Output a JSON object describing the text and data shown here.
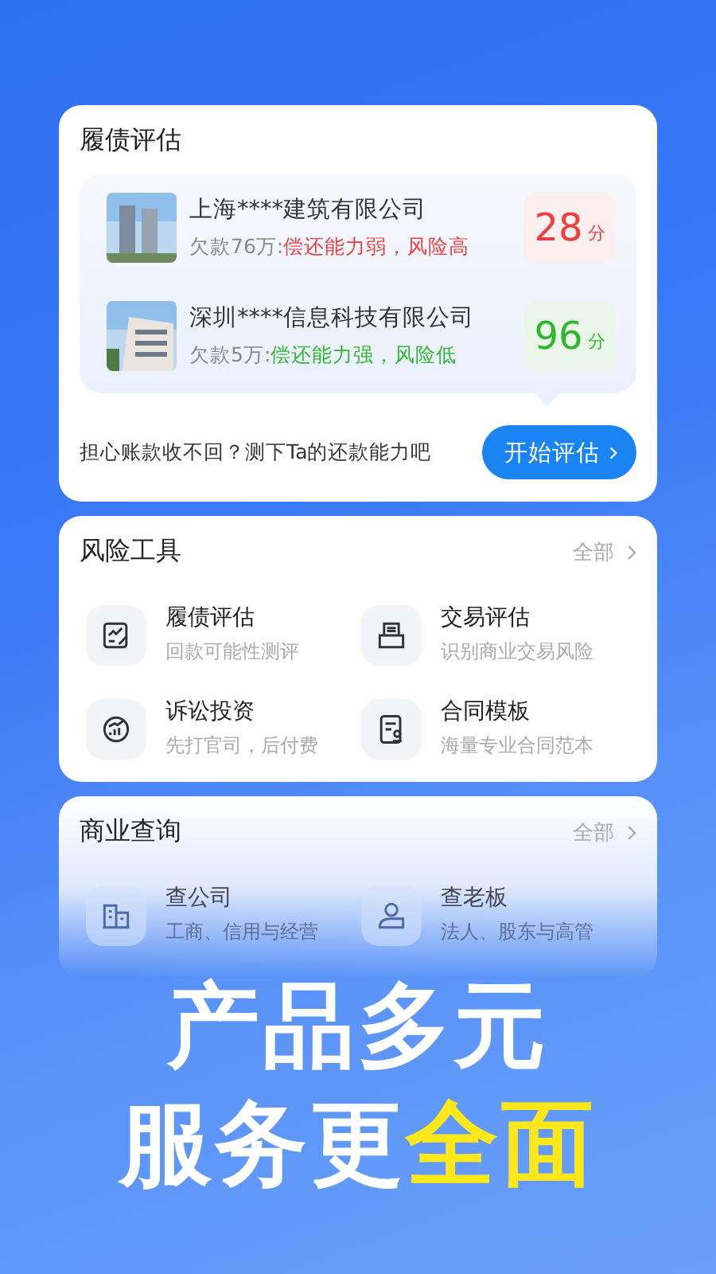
{
  "assessment": {
    "title": "履债评估",
    "companies": [
      {
        "name": "上海****建筑有限公司",
        "debt": "欠款76万:",
        "verdict": "偿还能力弱，风险高",
        "score": "28",
        "unit": "分",
        "high_risk": true
      },
      {
        "name": "深圳****信息科技有限公司",
        "debt": "欠款5万:",
        "verdict": "偿还能力强，风险低",
        "score": "96",
        "unit": "分",
        "high_risk": false
      }
    ],
    "prompt": "担心账款收不回？测下Ta的还款能力吧",
    "button": "开始评估"
  },
  "risk_tools": {
    "title": "风险工具",
    "more": "全部",
    "items": [
      {
        "kind": "chart-pen",
        "title": "履债评估",
        "subtitle": "回款可能性测评"
      },
      {
        "kind": "tray",
        "title": "交易评估",
        "subtitle": "识别商业交易风险"
      },
      {
        "kind": "gauge",
        "title": "诉讼投资",
        "subtitle": "先打官司，后付费"
      },
      {
        "kind": "document",
        "title": "合同模板",
        "subtitle": "海量专业合同范本"
      }
    ]
  },
  "business_query": {
    "title": "商业查询",
    "more": "全部",
    "items": [
      {
        "kind": "building",
        "title": "查公司",
        "subtitle": "工商、信用与经营"
      },
      {
        "kind": "person",
        "title": "查老板",
        "subtitle": "法人、股东与高管"
      }
    ]
  },
  "headline": {
    "line_1": "产品多元",
    "line_2": [
      {
        "text": "服务更",
        "highlight": false
      },
      {
        "text": "全面",
        "highlight": true
      }
    ]
  }
}
